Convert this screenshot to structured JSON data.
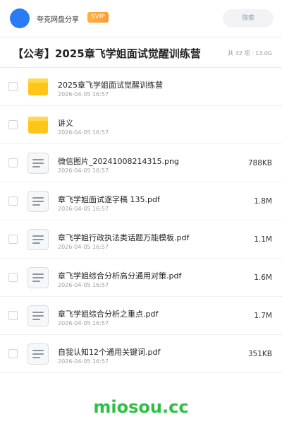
{
  "header": {
    "share_name": "夸克网盘分享",
    "badge": "SVIP",
    "search_placeholder": "搜索"
  },
  "folder": {
    "title": "【公考】2025章飞学姐面试觉醒训练营",
    "meta": "共 32 项 · 13.0G"
  },
  "files": [
    {
      "name": "2025章飞学姐面试觉醒训练营",
      "date": "2026-04-05 16:57",
      "size": "",
      "type": "folder"
    },
    {
      "name": "讲义",
      "date": "2026-04-05 16:57",
      "size": "",
      "type": "folder"
    },
    {
      "name": "微信图片_20241008214315.png",
      "date": "2026-04-05 16:57",
      "size": "788KB",
      "type": "file"
    },
    {
      "name": "章飞学姐面试逐字稿 135.pdf",
      "date": "2026-04-05 16:57",
      "size": "1.8M",
      "type": "file"
    },
    {
      "name": "章飞学姐行政执法类话题万能模板.pdf",
      "date": "2026-04-05 16:57",
      "size": "1.1M",
      "type": "file"
    },
    {
      "name": "章飞学姐综合分析高分通用对策.pdf",
      "date": "2026-04-05 16:57",
      "size": "1.6M",
      "type": "file"
    },
    {
      "name": "章飞学姐综合分析之重点.pdf",
      "date": "2026-04-05 16:57",
      "size": "1.7M",
      "type": "file"
    },
    {
      "name": "自我认知12个通用关键词.pdf",
      "date": "2026-04-05 16:57",
      "size": "351KB",
      "type": "file"
    }
  ],
  "watermark": "miosou.cc",
  "colors": {
    "avatar": "#2a7bf6",
    "badge": "#ff9a2e",
    "folder": "#ffc619",
    "watermark": "#2fbf45"
  }
}
